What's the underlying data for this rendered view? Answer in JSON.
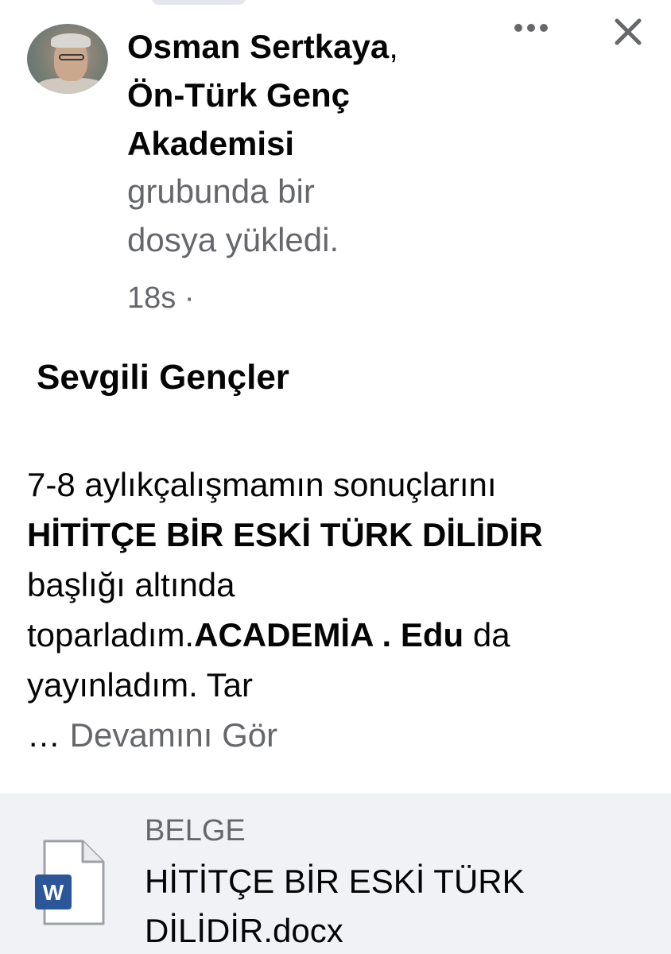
{
  "post": {
    "author_name": "Osman Sertkaya",
    "author_comma": ",",
    "group_name_line1": "Ön-Türk Genç",
    "group_name_line2": "Akademisi",
    "action_line1": "grubunda bir",
    "action_line2": "dosya yükledi.",
    "time": "18s",
    "separator": "·",
    "greeting": "Sevgili Gençler",
    "text": {
      "line1": "7-8 aylıkçalışmamın sonuçlarını",
      "line2_bold": "HİTİTÇE BİR ESKİ TÜRK DİLİDİR",
      "line3": "başlığı altında",
      "line4_start": "toparladım.",
      "line4_bold1": "ACADEMİA . Edu",
      "line4_end": " da",
      "line5": "yayınladım. Tar",
      "see_more_ellipsis": "… ",
      "see_more": "Devamını Gör"
    }
  },
  "attachment": {
    "type_label": "BELGE",
    "file_name_line1": "HİTİTÇE  BİR ESKİ TÜRK",
    "file_name_line2": "DİLİDİR.docx",
    "icon_letter": "W",
    "icon_color": "#2b579a"
  },
  "icons": {
    "more": "more-options-icon",
    "close": "close-icon",
    "document": "word-document-icon"
  }
}
